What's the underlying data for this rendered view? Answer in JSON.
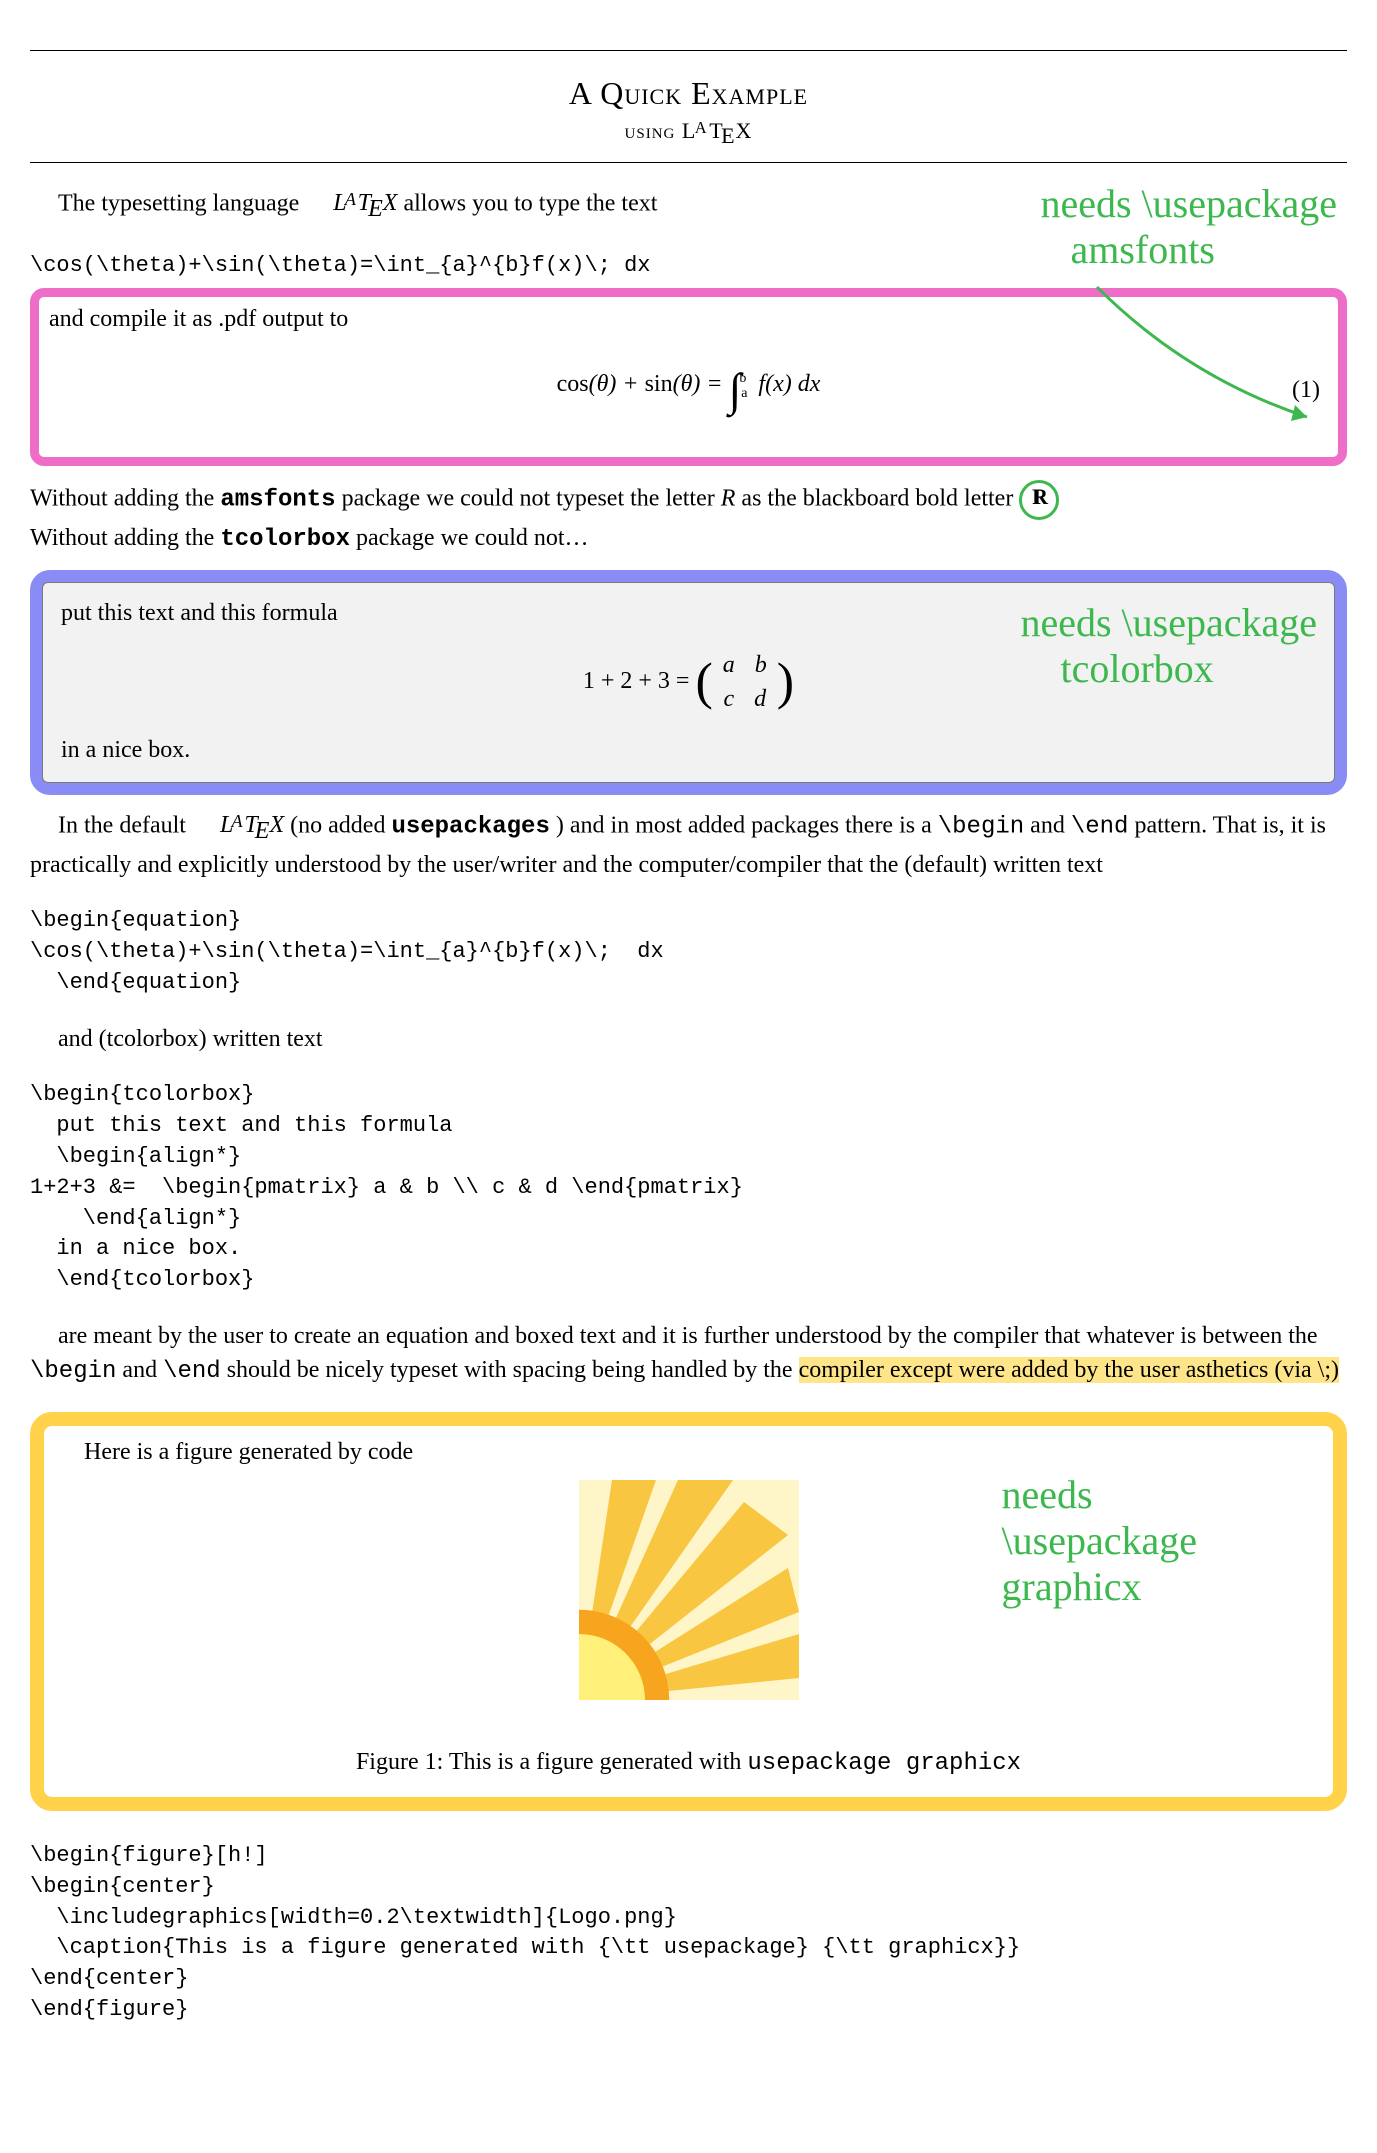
{
  "title": {
    "main": "A Quick Example",
    "sub": "using LᴬTᴇX"
  },
  "p_intro_pre": "The typesetting language ",
  "p_intro_post": " allows you to type the text",
  "code_inline_eq": "\\cos(\\theta)+\\sin(\\theta)=\\int_{a}^{b}f(x)\\;  dx",
  "compile_line": "and compile it as .pdf output to",
  "eq1_num": "(1)",
  "p_amsfonts_pre": "Without adding the ",
  "p_amsfonts_pkg": "amsfonts",
  "p_amsfonts_mid": " package we could not typeset the letter ",
  "p_amsfonts_R": "R",
  "p_amsfonts_post": " as the blackboard bold letter ",
  "p_tcolor_pre": "Without adding the ",
  "p_tcolor_pkg": "tcolorbox",
  "p_tcolor_post": " package we could not…",
  "tbox_top": "put this text and this formula",
  "tbox_bottom": "in a nice box.",
  "matrix": {
    "a": "a",
    "b": "b",
    "c": "c",
    "d": "d",
    "lhs": "1 + 2 + 3 ="
  },
  "p_begin1_pre": "In the default ",
  "p_begin1_mid": " (no added ",
  "p_begin1_pkg": "usepackages",
  "p_begin1_after": ") and in most added packages there is a ",
  "p_begin1_b": "\\begin",
  "p_begin1_and": " and ",
  "p_begin1_e": "\\end",
  "p_begin1_tail": " pattern. That is, it is practically and explicitly understood by the user/writer and the computer/compiler that the (default) written text",
  "code_block_eq": "\\begin{equation}\n\\cos(\\theta)+\\sin(\\theta)=\\int_{a}^{b}f(x)\\;  dx\n  \\end{equation}",
  "p_tcbox_written": "and (tcolorbox) written text",
  "code_block_tcb": "\\begin{tcolorbox}\n  put this text and this formula\n  \\begin{align*}\n1+2+3 &=  \\begin{pmatrix} a & b \\\\ c & d \\end{pmatrix}\n    \\end{align*}\n  in a nice box.\n  \\end{tcolorbox}",
  "p_meant_pre": "are meant by the user to create an equation and boxed text and it is further understood by the compiler that whatever is between the ",
  "p_meant_b": "\\begin",
  "p_meant_and": " and ",
  "p_meant_e": "\\end",
  "p_meant_mid": " should be nicely typeset with spacing being handled by the ",
  "p_meant_hl": "compiler except were added by the user asthetics (via \\;)",
  "p_figline": "Here is a figure generated by code",
  "figcaption_pre": "Figure 1: This is a figure generated with ",
  "figcaption_pkg": "usepackage graphicx",
  "code_block_fig": "\\begin{figure}[h!]\n\\begin{center}\n  \\includegraphics[width=0.2\\textwidth]{Logo.png}\n  \\caption{This is a figure generated with {\\tt usepackage} {\\tt graphicx}}\n\\end{center}\n\\end{figure}",
  "annotations": {
    "a1_line1": "needs \\usepackage",
    "a1_line2": "amsfonts",
    "a2_line1": "needs \\usepackage",
    "a2_line2": "tcolorbox",
    "a3_line1": "needs",
    "a3_line2": "\\usepackage",
    "a3_line3": "graphicx"
  }
}
